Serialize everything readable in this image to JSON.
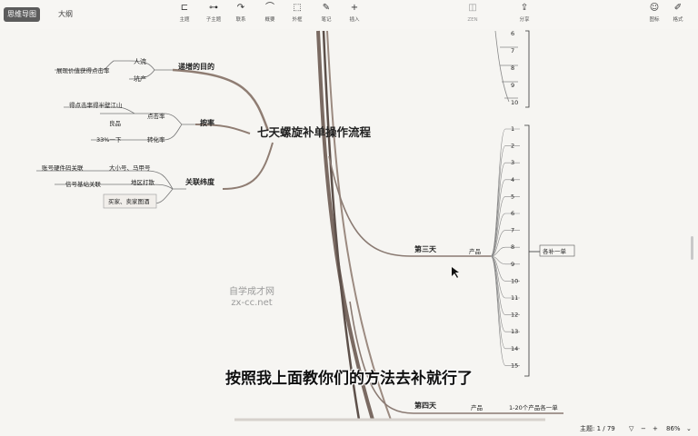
{
  "tabs": {
    "mindmap": "思维导图",
    "outline": "大纲"
  },
  "toolbar": {
    "topic": "主题",
    "subtopic": "子主题",
    "relation": "联系",
    "summary": "概要",
    "boundary": "外框",
    "note": "笔记",
    "insert": "插入",
    "zen": "ZEN",
    "share": "分享",
    "icon": "图标",
    "format": "格式"
  },
  "map": {
    "root": "七天螺旋补单操作流程",
    "purpose": {
      "title": "递增的目的",
      "child1": "人流",
      "child2": "坑产",
      "left": "展现价值获得点击率"
    },
    "conversion": {
      "title": "按率",
      "ctr": "点击率",
      "ctr_left": "得点击率得半壁江山",
      "good": "良品",
      "cvr": "转化率",
      "cvr_left": "33%一下"
    },
    "relation": {
      "title": "关联纬度",
      "a": "账号硬件码关联",
      "a_right": "大小号、马甲号",
      "b": "信号基站关联",
      "b_right": "地区打散",
      "c": "买家、卖家图酒"
    },
    "day3": {
      "title": "第三天",
      "product": "产品",
      "note": "各补一单",
      "items": [
        "1",
        "2",
        "3",
        "4",
        "5",
        "6",
        "7",
        "8",
        "9",
        "10",
        "11",
        "12",
        "13",
        "14",
        "15"
      ]
    },
    "top_items": [
      "6",
      "7",
      "8",
      "9",
      "10"
    ],
    "day4": {
      "title": "第四天",
      "product": "产品",
      "note": "1-20个产品各一单"
    }
  },
  "watermark": {
    "line1": "自学成才网",
    "line2": "zx-cc.net"
  },
  "subtitle": "按照我上面教你们的方法去补就行了",
  "status": {
    "topic_count": "主题: 1 / 79",
    "zoom": "86%"
  }
}
